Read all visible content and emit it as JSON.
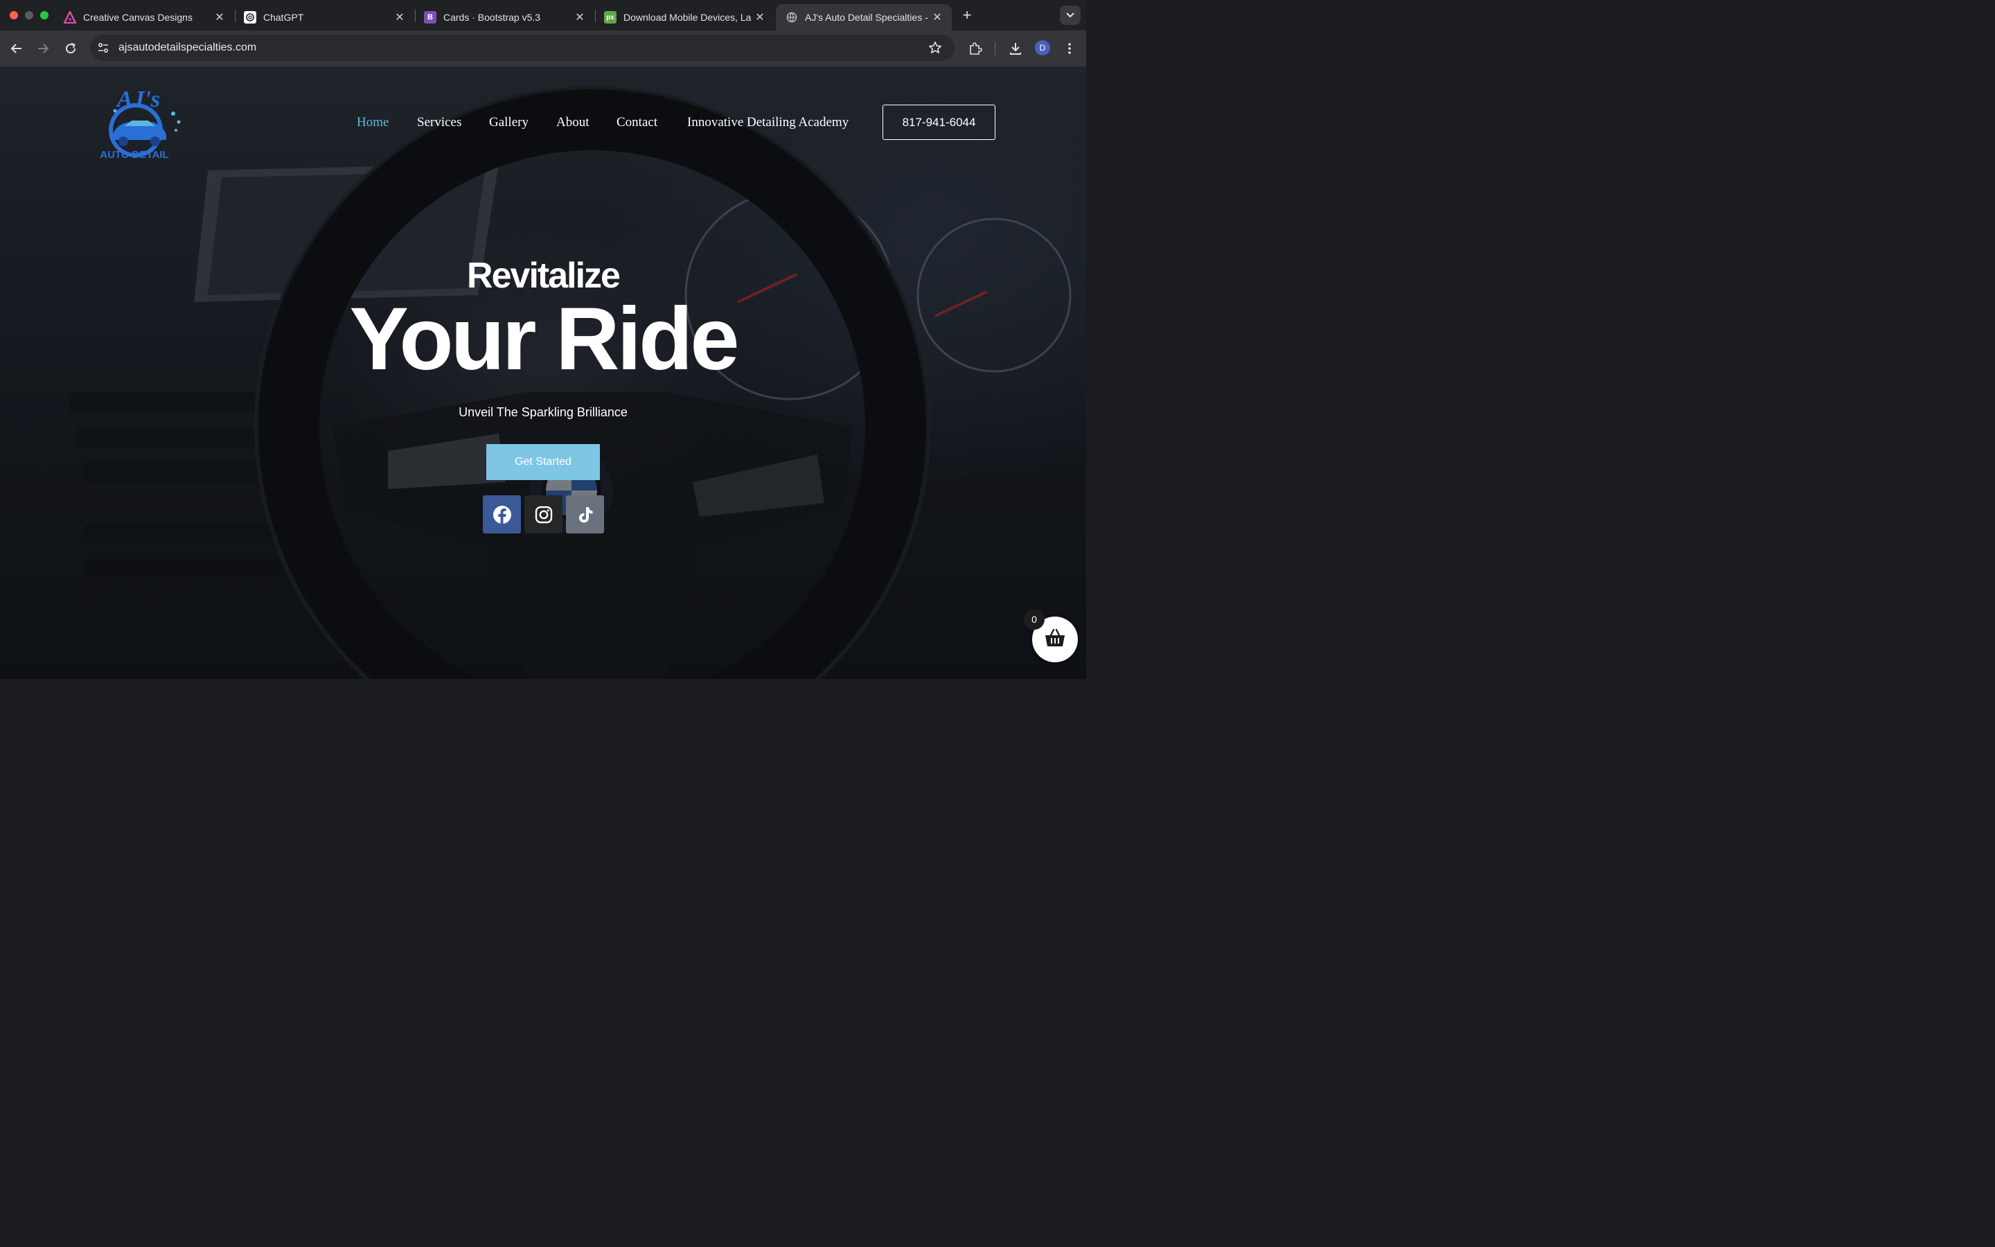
{
  "browser": {
    "tabs": [
      {
        "title": "Creative Canvas Designs",
        "favicon": "creative-canvas-icon"
      },
      {
        "title": "ChatGPT",
        "favicon": "chatgpt-icon"
      },
      {
        "title": "Cards · Bootstrap v5.3",
        "favicon": "bootstrap-icon",
        "favicon_text": "B"
      },
      {
        "title": "Download Mobile Devices, La",
        "favicon": "pixeden-icon",
        "favicon_text": "px"
      },
      {
        "title": "AJ's Auto Detail Specialties -",
        "favicon": "globe-icon",
        "active": true
      }
    ],
    "url": "ajsautodetailspecialties.com",
    "profile_initial": "D"
  },
  "site": {
    "logo": {
      "line1": "AJ's",
      "line2": "AUTO DETAIL"
    },
    "nav": [
      "Home",
      "Services",
      "Gallery",
      "About",
      "Contact",
      "Innovative Detailing Academy"
    ],
    "nav_active": "Home",
    "phone": "817-941-6044",
    "hero": {
      "heading_small": "Revitalize",
      "heading_big": "Your Ride",
      "tagline": "Unveil The Sparkling Brilliance",
      "cta": "Get Started"
    },
    "social": [
      {
        "name": "facebook-icon",
        "color": "#3b5998"
      },
      {
        "name": "instagram-icon",
        "color": "#262626"
      },
      {
        "name": "tiktok-icon",
        "color": "#69727d"
      }
    ],
    "cart_count": "0"
  },
  "colors": {
    "accent": "#5fb6dd",
    "cta_bg": "#7ec6e3",
    "logo_blue": "#2a6fd6"
  }
}
